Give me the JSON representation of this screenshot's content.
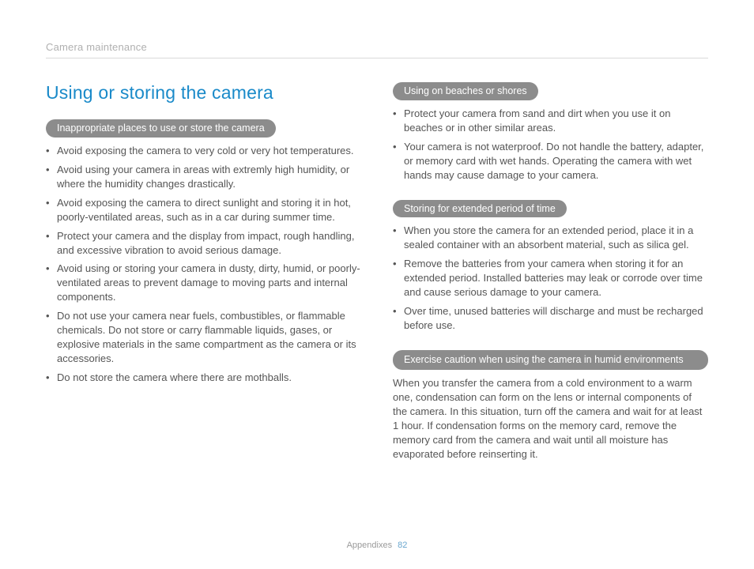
{
  "header": {
    "breadcrumb": "Camera maintenance"
  },
  "title": "Using or storing the camera",
  "left": {
    "group1": {
      "heading": "Inappropriate places to use or store the camera",
      "items": [
        "Avoid exposing the camera to very cold or very hot temperatures.",
        "Avoid using your camera in areas with extremly high humidity, or where the humidity changes drastically.",
        "Avoid exposing the camera to direct sunlight and storing it in hot, poorly-ventilated areas, such as in a car during summer time.",
        "Protect your camera and the display from impact, rough handling, and excessive vibration to avoid serious damage.",
        "Avoid using or storing your camera in dusty, dirty, humid, or poorly-ventilated areas to prevent damage to moving parts and internal components.",
        "Do not use your camera near fuels, combustibles, or flammable chemicals. Do not store or carry flammable liquids, gases, or explosive materials in the same compartment as the camera or its accessories.",
        "Do not store the camera where there are mothballs."
      ]
    }
  },
  "right": {
    "group1": {
      "heading": "Using on beaches or shores",
      "items": [
        "Protect your camera from sand and dirt when you use it on beaches or in other similar areas.",
        "Your camera is not waterproof. Do not handle the battery, adapter, or memory card with wet hands. Operating the camera with wet hands may cause damage to your camera."
      ]
    },
    "group2": {
      "heading": "Storing for extended period of time",
      "items": [
        "When you store the camera for an extended period, place it in a sealed container with an absorbent material, such as silica gel.",
        "Remove the batteries from your camera when storing it for an extended period. Installed batteries may leak or corrode over time and cause serious damage to your camera.",
        "Over time, unused batteries will discharge and must be recharged before use."
      ]
    },
    "group3": {
      "heading": "Exercise caution when using the camera in humid environments",
      "para": "When you transfer the camera from a cold environment to a warm one, condensation can form on the lens or internal components of the camera. In this situation, turn off the camera and wait for at least 1 hour. If condensation forms on the memory card, remove the memory card from the camera and wait until all moisture has evaporated before reinserting it."
    }
  },
  "footer": {
    "section": "Appendixes",
    "page": "82"
  }
}
